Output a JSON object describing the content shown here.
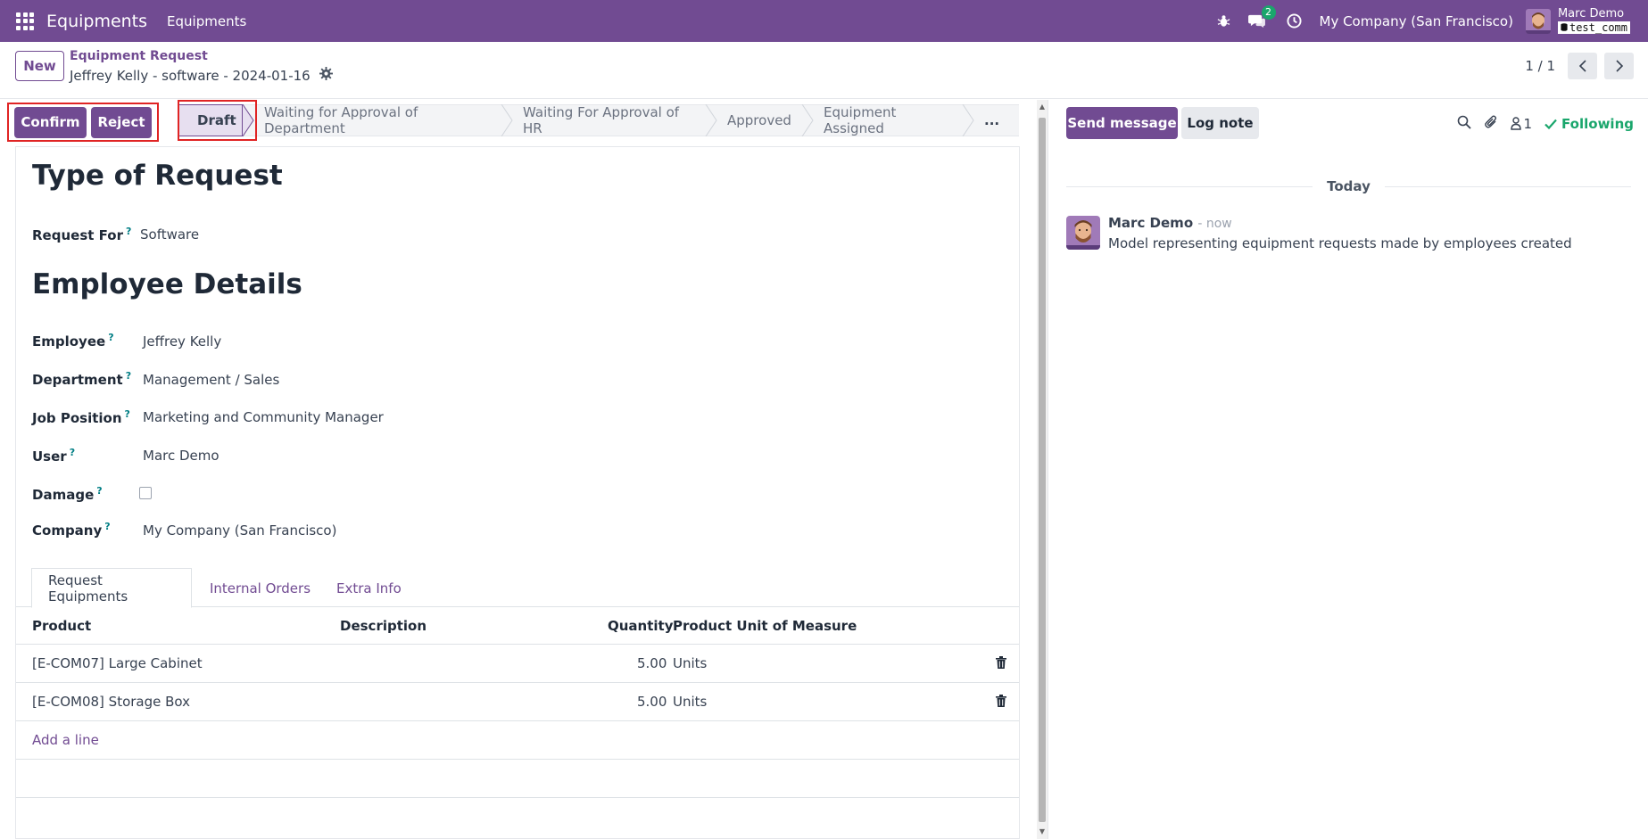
{
  "navbar": {
    "brand": "Equipments",
    "menu_item": "Equipments",
    "chat_badge": "2",
    "company": "My Company (San Francisco)",
    "user_name": "Marc Demo",
    "db_name": "test_comm"
  },
  "control_panel": {
    "new_label": "New",
    "breadcrumb_parent": "Equipment Request",
    "record_name": "Jeffrey Kelly - software - 2024-01-16",
    "pager_value": "1 / 1"
  },
  "actions": {
    "confirm_label": "Confirm",
    "reject_label": "Reject"
  },
  "statusbar": {
    "stages": [
      "Draft",
      "Waiting for Approval of Department",
      "Waiting For Approval of HR",
      "Approved",
      "Equipment Assigned",
      "..."
    ],
    "active": "Draft"
  },
  "form": {
    "section_type": "Type of Request",
    "request_for_label": "Request For",
    "request_for_value": "Software",
    "section_employee": "Employee Details",
    "employee_label": "Employee",
    "employee_value": "Jeffrey Kelly",
    "department_label": "Department",
    "department_value": "Management / Sales",
    "job_label": "Job Position",
    "job_value": "Marketing and Community Manager",
    "user_label": "User",
    "user_value": "Marc Demo",
    "damage_label": "Damage",
    "damage_checked": false,
    "company_label": "Company",
    "company_value": "My Company (San Francisco)",
    "help_mark": "?"
  },
  "tabs": [
    "Request Equipments",
    "Internal Orders",
    "Extra Info"
  ],
  "table": {
    "headers": [
      "Product",
      "Description",
      "Quantity",
      "Product Unit of Measure"
    ],
    "rows": [
      {
        "product": "[E-COM07] Large Cabinet",
        "description": "",
        "quantity": "5.00",
        "uom": "Units"
      },
      {
        "product": "[E-COM08] Storage Box",
        "description": "",
        "quantity": "5.00",
        "uom": "Units"
      }
    ],
    "add_line": "Add a line"
  },
  "chatter": {
    "send_label": "Send message",
    "log_label": "Log note",
    "followers_count": "1",
    "following_label": "Following",
    "date_separator": "Today",
    "message": {
      "author": "Marc Demo",
      "time": "- now",
      "body": "Model representing equipment requests made by employees created"
    }
  },
  "colors": {
    "brand": "#714B92",
    "success": "#1AA66C",
    "highlight": "#e02424"
  }
}
